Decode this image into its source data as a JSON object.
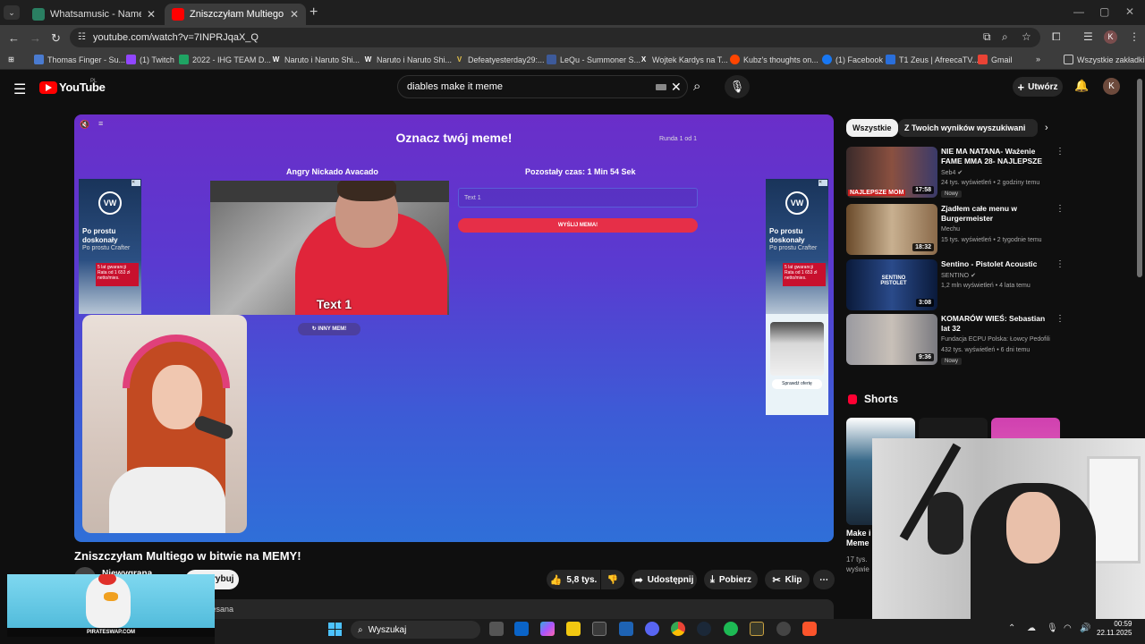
{
  "browser": {
    "tabs": [
      {
        "label": "Whatsamusic - Name That Tun",
        "active": false
      },
      {
        "label": "Zniszczyłam Multiego w bitwie",
        "active": true
      }
    ],
    "url": "youtube.com/watch?v=7INPRJqaX_Q",
    "bookmarks": [
      "Thomas Finger - Su...",
      "(1) Twitch",
      "2022 - IHG TEAM D...",
      "Naruto i Naruto Shi...",
      "Naruto i Naruto Shi...",
      "Defeatyesterday29:...",
      "LeQu - Summoner S...",
      "Wojtek Kardys na T...",
      "Kubz's thoughts on...",
      "(1) Facebook",
      "T1 Zeus | AfreecaTV...",
      "Gmail"
    ],
    "all_bookmarks_label": "Wszystkie zakładki",
    "profile_initial": "K"
  },
  "youtube": {
    "logo_text": "YouTube",
    "country": "PL",
    "search_query": "diables make it meme",
    "create_label": "Utwórz",
    "avatar_initial": "K"
  },
  "video": {
    "game_title": "Oznacz twój meme!",
    "round": "Runda 1 od 1",
    "meme_name": "Angry Nickado Avacado",
    "timer": "Pozostały czas: 1 Min 54 Sek",
    "meme_caption": "Text 1",
    "text_input_placeholder": "Text 1",
    "send_button": "WYŚLIJ MEMA!",
    "other_meme_button": "INNY MEM!",
    "ad": {
      "brand": "VW",
      "headline": "Po prostu doskonały",
      "subline": "Po prostu Crafter",
      "badge_line1": "5 lat gwarancji",
      "badge_line2": "Rata od 1 653 zł",
      "badge_line3": "netto/mies.",
      "cta": "Sprawdź ofertę"
    }
  },
  "under_video": {
    "title": "Zniszczyłam Multiego w bitwie na MEMY!",
    "channel": "Niewygrana",
    "subscribe": "Subskrybuj",
    "like_count": "5,8 tys.",
    "share": "Udostępnij",
    "download": "Pobierz",
    "clip": "Klip",
    "desc_fragment": "zesana"
  },
  "sidebar": {
    "chips": [
      "Wszystkie",
      "Z Twoich wyników wyszukiwania"
    ],
    "recommendations": [
      {
        "title": "NIE MA NATANA- Ważenie FAME MMA 28- NAJLEPSZE ...",
        "channel": "Seb4",
        "meta": "24 tys. wyświetleń • 2 godziny temu",
        "badge": "Nowy",
        "duration": "17:58",
        "thumb_text": "NAJLEPSZE MOM"
      },
      {
        "title": "Zjadłem całe menu w Burgermeister",
        "channel": "Mechu",
        "meta": "15 tys. wyświetleń • 2 tygodnie temu",
        "badge": "",
        "duration": "18:32",
        "thumb_text": ""
      },
      {
        "title": "Sentino - Pistolet Acoustic",
        "channel": "SENTINO",
        "meta": "1,2 mln wyświetleń • 4 lata temu",
        "badge": "",
        "duration": "3:08",
        "thumb_text": "SENTINO PISTOLET"
      },
      {
        "title": "KOMARÓW WIEŚ: Sebastian lat 32",
        "channel": "Fundacja ECPU Polska: Łowcy Pedofili",
        "meta": "432 tys. wyświetleń • 6 dni temu",
        "badge": "Nowy",
        "duration": "9:36",
        "thumb_text": ""
      }
    ],
    "shorts_heading": "Shorts",
    "short_title": "Make i\nMeme",
    "short_views": "17 tys.\nwyświe"
  },
  "overlay": {
    "ad_footer": "PIRATESWAP.COM"
  },
  "taskbar": {
    "search_label": "Wyszukaj",
    "time": "00:59",
    "date": "22.11.2025"
  },
  "colors": {
    "yt_red": "#ff0000",
    "send_button": "#e62f48",
    "video_gradient_top": "#6a2ec9",
    "video_gradient_bottom": "#2f6fd8"
  }
}
